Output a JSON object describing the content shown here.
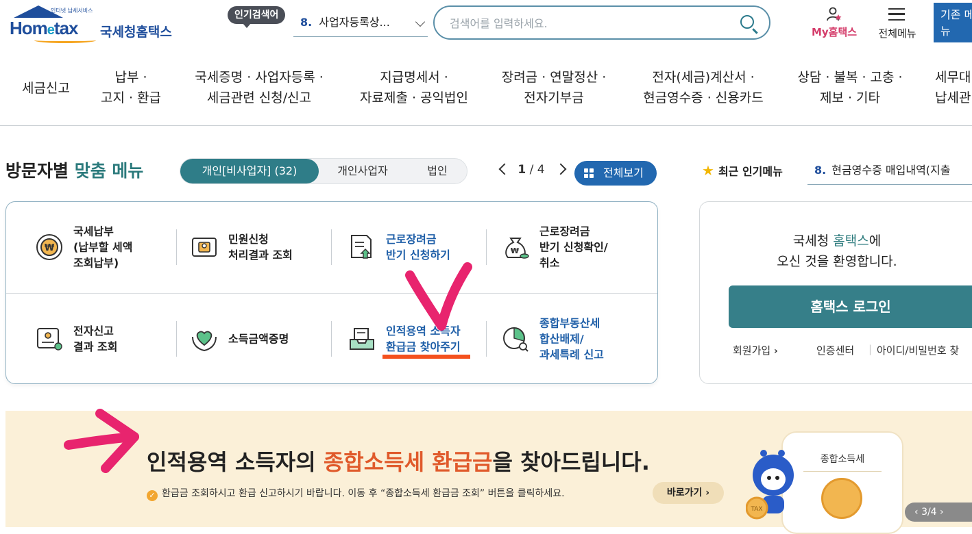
{
  "header": {
    "logo_tagline": "인터넷 납세서비스",
    "logo_brand_pre": "Hom",
    "logo_brand_e": "e",
    "logo_brand_post": "tax",
    "logo_ko": "국세청홈택스",
    "popular_badge": "인기검색어",
    "popular_num": "8.",
    "popular_value": "사업자등록상...",
    "search_placeholder": "검색어를 입력하세요.",
    "my_hometax": "My홈택스",
    "all_menu": "전체메뉴",
    "legacy_menu": "기존 메뉴"
  },
  "gnb": [
    "세금신고",
    "납부 ·\n고지 · 환급",
    "국세증명 · 사업자등록 ·\n세금관련 신청/신고",
    "지급명세서 ·\n자료제출 · 공익법인",
    "장려금 · 연말정산 ·\n전자기부금",
    "전자(세금)계산서 ·\n현금영수증 · 신용카드",
    "상담 · 불복 · 고충 ·\n제보 · 기타",
    "세무대리\n납세관리"
  ],
  "section": {
    "title_pre": "방문자별 ",
    "title_hl": "맞춤 메뉴",
    "tabs": [
      "개인[비사업자] (32)",
      "개인사업자",
      "법인"
    ],
    "page_current": "1",
    "page_sep": " / ",
    "page_total": "4",
    "view_all": "전체보기",
    "recent_label": "최근 인기메뉴",
    "recent_num": "8.",
    "recent_value": "현금영수증 매입내역(지출"
  },
  "menu_items": [
    {
      "label": "국세납부\n(납부할 세액\n조회납부)",
      "icon": "won-coin-icon"
    },
    {
      "label": "민원신청\n처리결과 조회",
      "icon": "document-person-icon"
    },
    {
      "label": "근로장려금\n반기 신청하기",
      "icon": "form-upload-icon"
    },
    {
      "label": "근로장려금\n반기 신청확인/\n취소",
      "icon": "money-bag-icon"
    },
    {
      "label": "전자신고\n결과 조회",
      "icon": "certificate-icon"
    },
    {
      "label": "소득금액증명",
      "icon": "heart-hands-icon"
    },
    {
      "label": "인적용역 소득자\n환급금 찾아주기",
      "icon": "tray-document-icon"
    },
    {
      "label": "종합부동산세\n합산배제/\n과세특례 신고",
      "icon": "pie-search-icon"
    }
  ],
  "login": {
    "welcome_pre": "국세청 ",
    "welcome_hl": "홈택스",
    "welcome_post": "에\n오신 것을 환영합니다.",
    "login_button": "홈택스 로그인",
    "signup": "회원가입",
    "cert_center": "인증센터",
    "find_id": "아이디/비밀번호 찾"
  },
  "banner": {
    "headline_pre": "인적용역 소득자의 ",
    "headline_hl": "종합소득세 환급금",
    "headline_post": "을 찾아드립니다.",
    "sub": "환급금 조회하시고 환급 신고하시기 바랍니다. 이동 후 “종합소득세 환급금 조회” 버튼을 클릭하세요.",
    "goto": "바로가기",
    "phone_title": "종합소득세",
    "coin_text": "TAX",
    "pager": "3/4"
  },
  "colors": {
    "brand_blue": "#1f4e9c",
    "teal": "#2f7d88",
    "link_blue": "#1f5fa8",
    "highlight_orange": "#e05a2b",
    "annotation_pink": "#e8246e",
    "annotation_underline": "#f4511e"
  }
}
